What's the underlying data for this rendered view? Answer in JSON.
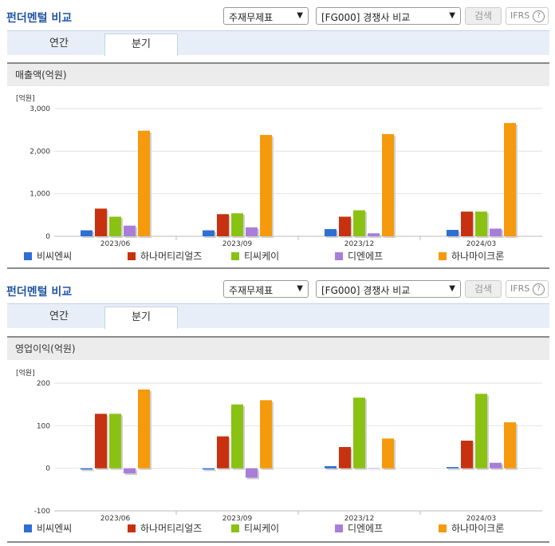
{
  "colors": {
    "title": "#2255a4",
    "series": [
      "#2f6fd4",
      "#c8310f",
      "#8ac213",
      "#a87ed8",
      "#f59a0c"
    ]
  },
  "panels": [
    {
      "title": "펀더멘털 비교",
      "select_statement": "주재무제표",
      "select_compare": "[FG000] 경쟁사 비교",
      "search_label": "검색",
      "ifrs_label": "IFRS",
      "help_icon_glyph": "?",
      "tabs": [
        "연간",
        "분기"
      ],
      "active_tab": 1,
      "chart_title": "매출액(억원)",
      "unit_label": "[억원]",
      "legend": [
        "비씨엔씨",
        "하나머티리얼즈",
        "티씨케이",
        "디엔에프",
        "하나마이크론"
      ]
    },
    {
      "title": "펀더멘털 비교",
      "select_statement": "주재무제표",
      "select_compare": "[FG000] 경쟁사 비교",
      "search_label": "검색",
      "ifrs_label": "IFRS",
      "help_icon_glyph": "?",
      "tabs": [
        "연간",
        "분기"
      ],
      "active_tab": 1,
      "chart_title": "영업이익(억원)",
      "unit_label": "[억원]",
      "legend": [
        "비씨엔씨",
        "하나머티리얼즈",
        "티씨케이",
        "디엔에프",
        "하나마이크론"
      ]
    }
  ],
  "chart_data": [
    {
      "type": "bar",
      "title": "매출액(억원)",
      "ylabel": "[억원]",
      "categories": [
        "2023/06",
        "2023/09",
        "2023/12",
        "2024/03"
      ],
      "ylim": [
        0,
        3000
      ],
      "yticks": [
        0,
        1000,
        2000,
        3000
      ],
      "ytick_labels": [
        "0",
        "1,000",
        "2,000",
        "3,000"
      ],
      "series": [
        {
          "name": "비씨엔씨",
          "values": [
            140,
            140,
            170,
            150
          ]
        },
        {
          "name": "하나머티리얼즈",
          "values": [
            650,
            520,
            460,
            580
          ]
        },
        {
          "name": "티씨케이",
          "values": [
            460,
            540,
            610,
            580
          ]
        },
        {
          "name": "디엔에프",
          "values": [
            250,
            210,
            70,
            180
          ]
        },
        {
          "name": "하나마이크론",
          "values": [
            2480,
            2380,
            2400,
            2660
          ]
        }
      ]
    },
    {
      "type": "bar",
      "title": "영업이익(억원)",
      "ylabel": "[억원]",
      "categories": [
        "2023/06",
        "2023/09",
        "2023/12",
        "2024/03"
      ],
      "ylim": [
        -100,
        200
      ],
      "yticks": [
        -100,
        0,
        100,
        200
      ],
      "ytick_labels": [
        "-100",
        "0",
        "100",
        "200"
      ],
      "series": [
        {
          "name": "비씨엔씨",
          "values": [
            -3,
            -3,
            5,
            3
          ]
        },
        {
          "name": "하나머티리얼즈",
          "values": [
            128,
            75,
            50,
            65
          ]
        },
        {
          "name": "티씨케이",
          "values": [
            128,
            150,
            166,
            175
          ]
        },
        {
          "name": "디엔에프",
          "values": [
            -12,
            -22,
            0,
            13
          ]
        },
        {
          "name": "하나마이크론",
          "values": [
            185,
            160,
            70,
            108
          ]
        }
      ]
    }
  ]
}
